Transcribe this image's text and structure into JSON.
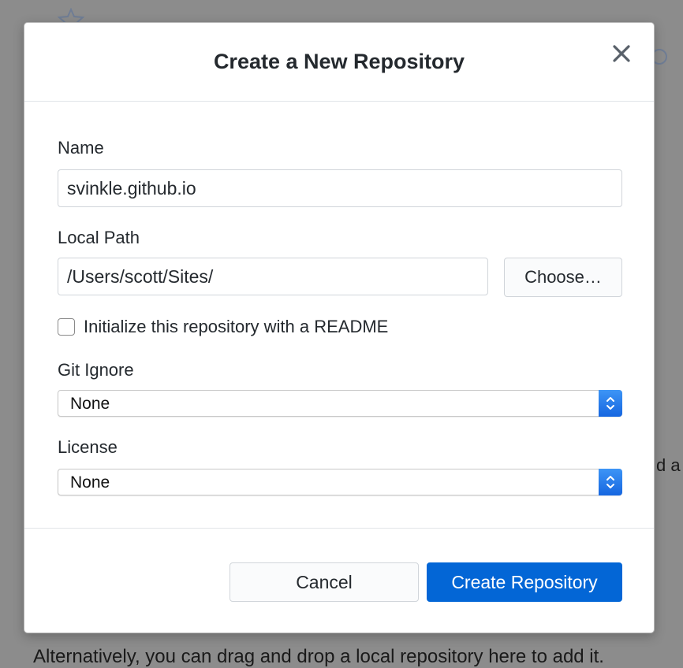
{
  "colors": {
    "accent": "#0366d6",
    "backdrop": "#8c8c8c",
    "text": "#24292e",
    "select_stepper": "#1a72ea"
  },
  "background": {
    "right_text_fragment": "d a",
    "bottom_text": "Alternatively, you can drag and drop a local repository here to add it.",
    "icons": [
      "star-icon",
      "circle-icon"
    ]
  },
  "dialog": {
    "title": "Create a New Repository",
    "close_icon": "close-icon",
    "name": {
      "label": "Name",
      "value": "svinkle.github.io"
    },
    "local_path": {
      "label": "Local Path",
      "value": "/Users/scott/Sites/",
      "choose_label": "Choose…"
    },
    "readme": {
      "label": "Initialize this repository with a README",
      "checked": false
    },
    "git_ignore": {
      "label": "Git Ignore",
      "selected": "None"
    },
    "license": {
      "label": "License",
      "selected": "None"
    },
    "footer": {
      "cancel_label": "Cancel",
      "create_label": "Create Repository"
    }
  }
}
